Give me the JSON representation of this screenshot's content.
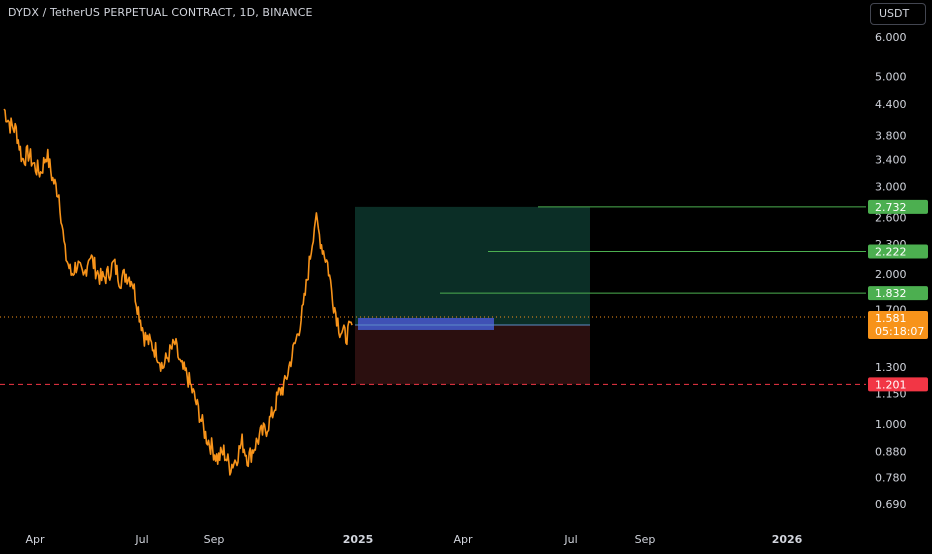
{
  "header": {
    "symbol_title": "DYDX / TetherUS PERPETUAL CONTRACT, 1D, BINANCE",
    "currency_button": "USDT"
  },
  "colors": {
    "background": "#000000",
    "candle": "#f7931a",
    "target_line": "#4caf50",
    "target_label_bg": "#4caf50",
    "stop_label_bg": "#f23645",
    "price_label_bg": "#f7931a",
    "profit_zone": "#0b2e26",
    "loss_zone": "#2b0f0f",
    "entry_box": "#3f51b5"
  },
  "chart_data": {
    "type": "line",
    "y_scale": "log",
    "ylim": [
      0.64,
      6.6
    ],
    "y_ticks": [
      "6.000",
      "5.000",
      "4.400",
      "3.800",
      "3.400",
      "3.000",
      "2.600",
      "2.300",
      "2.000",
      "1.700",
      "1.300",
      "1.150",
      "1.000",
      "0.880",
      "0.780",
      "0.690"
    ],
    "x_ticks": [
      "Apr",
      "Jul",
      "Sep",
      "2025",
      "Apr",
      "Jul",
      "Sep",
      "2026"
    ],
    "series": [
      {
        "values": [
          4.3,
          4.0,
          3.9,
          3.4,
          3.5,
          3.3,
          3.2,
          3.5,
          3.1,
          2.9,
          2.2,
          2.0,
          2.1,
          1.95,
          2.2,
          2.05,
          1.95,
          2.0,
          2.1,
          1.95,
          2.0,
          1.95,
          1.7,
          1.5,
          1.45,
          1.4,
          1.3,
          1.38,
          1.45,
          1.3,
          1.25,
          1.15,
          1.05,
          0.95,
          0.9,
          0.85,
          0.88,
          0.82,
          0.85,
          0.92,
          0.85,
          0.9,
          0.95,
          0.98,
          1.05,
          1.15,
          1.2,
          1.35,
          1.5,
          1.7,
          2.1,
          2.6,
          2.3,
          2.1,
          1.75,
          1.55,
          1.5,
          1.58
        ]
      }
    ],
    "annotations": {
      "current_price": "1.581",
      "countdown": "05:18:07",
      "stop_loss": "1.201",
      "targets": [
        "1.832",
        "2.222",
        "2.732"
      ]
    }
  }
}
